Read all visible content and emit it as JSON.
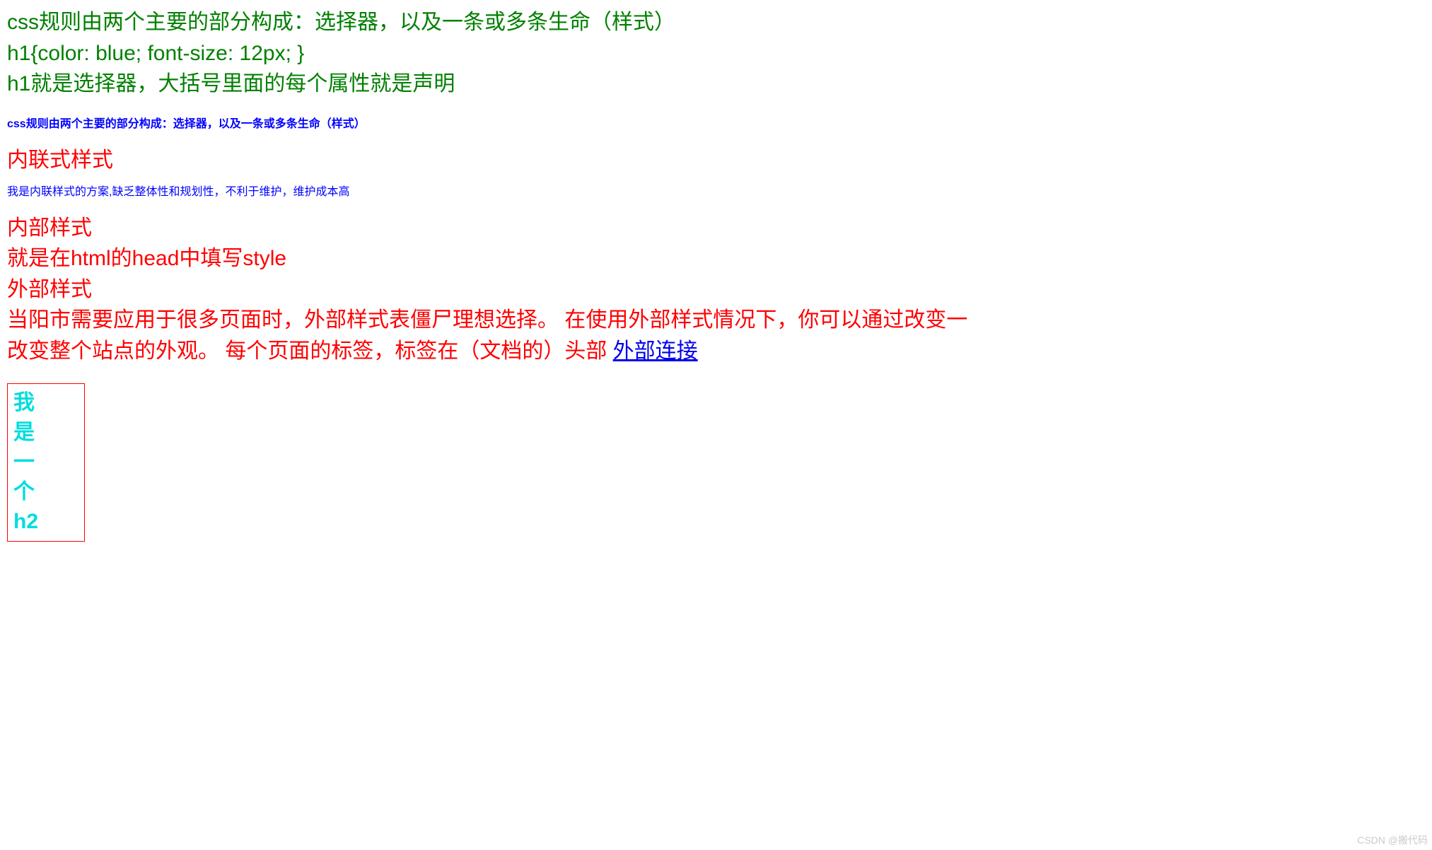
{
  "green": {
    "line1": "css规则由两个主要的部分构成：选择器，以及一条或多条生命（样式）",
    "line2": "h1{color: blue; font-size: 12px; }",
    "line3": "h1就是选择器，大括号里面的每个属性就是声明"
  },
  "blueSmall1": "css规则由两个主要的部分构成：选择器，以及一条或多条生命（样式）",
  "redHeading1": "内联式样式",
  "blueSmall2": "我是内联样式的方案,缺乏整体性和规划性，不利于维护，维护成本高",
  "red": {
    "line1": "内部样式",
    "line2": "就是在html的head中填写style",
    "line3": "外部样式",
    "line4a": "当阳市需要应用于很多页面时，外部样式表僵尸理想选择。 在使用外部样式情况下，你可以通过改变一",
    "line4b": "改变整个站点的外观。 每个页面的标签，标签在（文档的）头部 ",
    "link": "外部连接"
  },
  "h2box": {
    "c1": "我",
    "c2": "是",
    "c3": "一",
    "c4": "个",
    "c5": "h2"
  },
  "watermark": "CSDN @搬代码"
}
